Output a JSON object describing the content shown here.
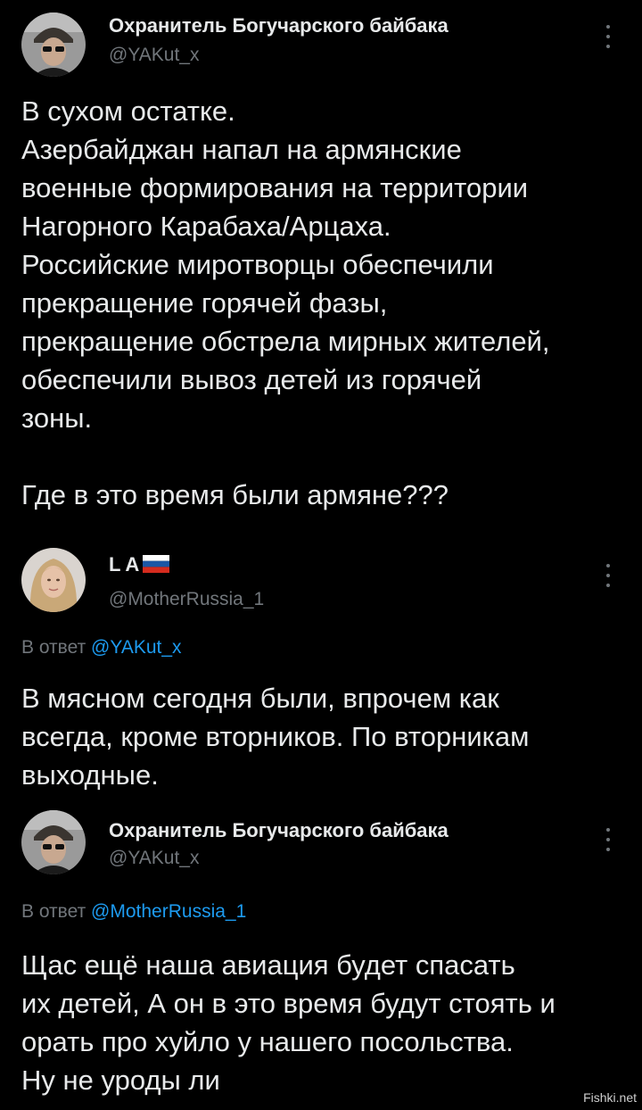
{
  "tweets": [
    {
      "author_name": "Охранитель Богучарского байбака",
      "author_handle": "@YAKut_x",
      "reply_prefix": "",
      "reply_to": "",
      "text_lines": [
        "В сухом остатке.",
        "Азербайджан напал на армянские",
        "военные формирования на территории",
        "Нагорного Карабаха/Арцаха.",
        "Российские миротворцы обеспечили",
        "прекращение горячей фазы,",
        "прекращение обстрела мирных жителей,",
        "обеспечили вывоз детей из горячей",
        "зоны.",
        "",
        "Где в это время были армяне???"
      ]
    },
    {
      "author_name": "L A",
      "author_badge": "russia-flag-icon",
      "author_handle": "@MotherRussia_1",
      "reply_prefix": "В ответ",
      "reply_to": "@YAKut_x",
      "text_lines": [
        "В мясном сегодня были, впрочем как",
        "всегда, кроме вторников. По вторникам",
        "выходные."
      ]
    },
    {
      "author_name": "Охранитель Богучарского байбака",
      "author_handle": "@YAKut_x",
      "reply_prefix": "В ответ",
      "reply_to": "@MotherRussia_1",
      "text_lines": [
        "Щас ещё наша авиация будет спасать",
        "их детей, А он в это время будут стоять и",
        "орать про хуйло у нашего посольства.",
        "Ну не уроды ли"
      ]
    }
  ],
  "watermark": "Fishki.net",
  "colors": {
    "background": "#000000",
    "text": "#e7e9ea",
    "secondary": "#71767b",
    "link": "#1d9bf0"
  }
}
